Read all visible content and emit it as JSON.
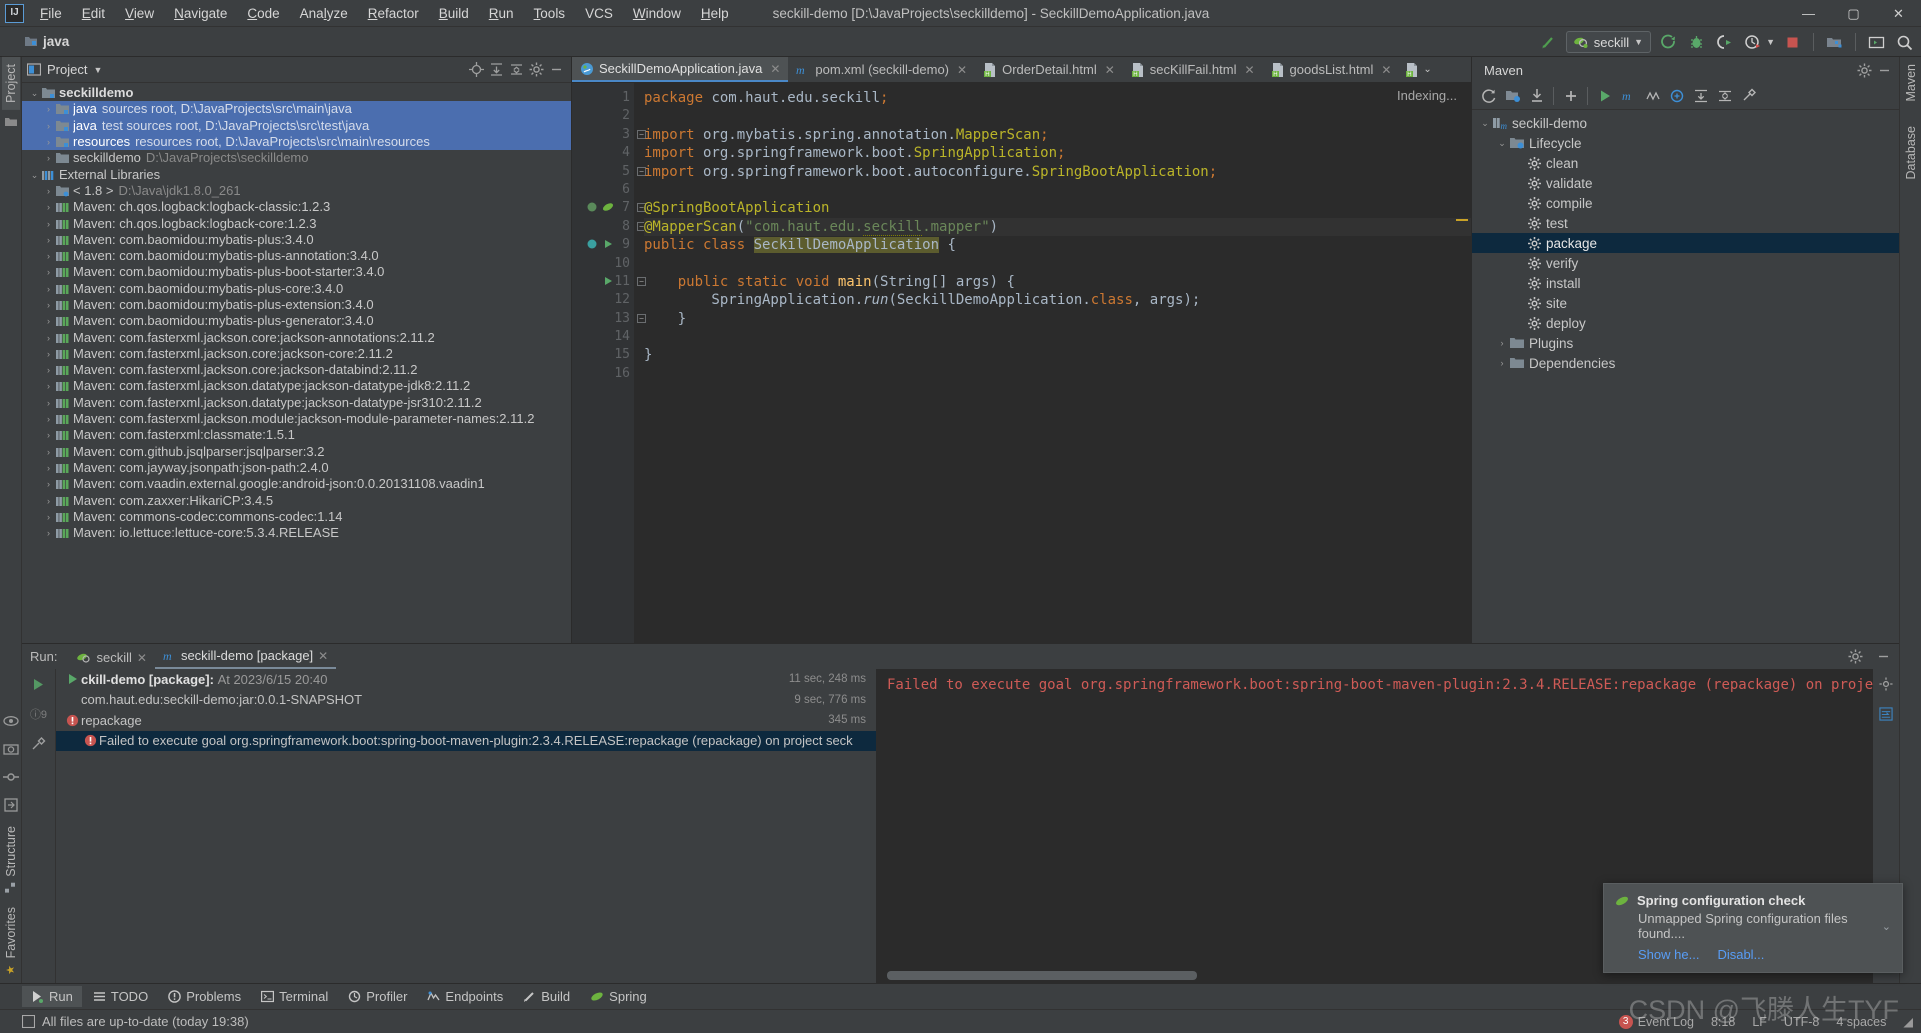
{
  "window": {
    "title": "seckill-demo [D:\\JavaProjects\\seckilldemo] - SeckillDemoApplication.java",
    "minimize": "—",
    "maximize": "▢",
    "close": "✕"
  },
  "menu": [
    "File",
    "Edit",
    "View",
    "Navigate",
    "Code",
    "Analyze",
    "Refactor",
    "Build",
    "Run",
    "Tools",
    "VCS",
    "Window",
    "Help"
  ],
  "navbar": {
    "crumb": "java"
  },
  "toolbar": {
    "run_config": "seckill",
    "icons": [
      "build-icon",
      "run-icon",
      "debug-icon",
      "run-with-coverage-icon",
      "profiler-icon",
      "stop-icon",
      "project-structure-icon",
      "terminal-icon",
      "search-everywhere-icon"
    ]
  },
  "left_strip": {
    "tabs": [
      "Project"
    ],
    "bottom_tabs": [
      "Structure",
      "Favorites"
    ]
  },
  "right_strip": {
    "tabs": [
      "Maven",
      "Database"
    ]
  },
  "project_panel": {
    "title": "Project",
    "tree": [
      {
        "indent": 0,
        "arrow": "v",
        "icon": "module-icon",
        "label": "seckilldemo",
        "dim": "",
        "bold": true,
        "selected": false
      },
      {
        "indent": 1,
        "arrow": ">",
        "icon": "source-folder-icon",
        "label": "java",
        "dim": "sources root,  D:\\JavaProjects\\src\\main\\java",
        "bold": false,
        "selected": true
      },
      {
        "indent": 1,
        "arrow": ">",
        "icon": "source-folder-icon",
        "label": "java",
        "dim": "test sources root,  D:\\JavaProjects\\src\\test\\java",
        "bold": false,
        "selected": true
      },
      {
        "indent": 1,
        "arrow": ">",
        "icon": "source-folder-icon",
        "label": "resources",
        "dim": "resources root,  D:\\JavaProjects\\src\\main\\resources",
        "bold": false,
        "selected": true
      },
      {
        "indent": 1,
        "arrow": ">",
        "icon": "folder-icon",
        "label": "seckilldemo",
        "dim": "D:\\JavaProjects\\seckilldemo",
        "bold": false,
        "selected": false
      },
      {
        "indent": 0,
        "arrow": "v",
        "icon": "libraries-icon",
        "label": "External Libraries",
        "dim": "",
        "bold": false,
        "selected": false
      },
      {
        "indent": 1,
        "arrow": ">",
        "icon": "jdk-icon",
        "label": "< 1.8 >",
        "dim": "D:\\Java\\jdk1.8.0_261",
        "bold": false,
        "selected": false
      },
      {
        "indent": 1,
        "arrow": ">",
        "icon": "maven-lib-icon",
        "label": "Maven: ch.qos.logback:logback-classic:1.2.3",
        "dim": "",
        "bold": false,
        "selected": false
      },
      {
        "indent": 1,
        "arrow": ">",
        "icon": "maven-lib-icon",
        "label": "Maven: ch.qos.logback:logback-core:1.2.3",
        "dim": "",
        "bold": false,
        "selected": false
      },
      {
        "indent": 1,
        "arrow": ">",
        "icon": "maven-lib-icon",
        "label": "Maven: com.baomidou:mybatis-plus:3.4.0",
        "dim": "",
        "bold": false,
        "selected": false
      },
      {
        "indent": 1,
        "arrow": ">",
        "icon": "maven-lib-icon",
        "label": "Maven: com.baomidou:mybatis-plus-annotation:3.4.0",
        "dim": "",
        "bold": false,
        "selected": false
      },
      {
        "indent": 1,
        "arrow": ">",
        "icon": "maven-lib-icon",
        "label": "Maven: com.baomidou:mybatis-plus-boot-starter:3.4.0",
        "dim": "",
        "bold": false,
        "selected": false
      },
      {
        "indent": 1,
        "arrow": ">",
        "icon": "maven-lib-icon",
        "label": "Maven: com.baomidou:mybatis-plus-core:3.4.0",
        "dim": "",
        "bold": false,
        "selected": false
      },
      {
        "indent": 1,
        "arrow": ">",
        "icon": "maven-lib-icon",
        "label": "Maven: com.baomidou:mybatis-plus-extension:3.4.0",
        "dim": "",
        "bold": false,
        "selected": false
      },
      {
        "indent": 1,
        "arrow": ">",
        "icon": "maven-lib-icon",
        "label": "Maven: com.baomidou:mybatis-plus-generator:3.4.0",
        "dim": "",
        "bold": false,
        "selected": false
      },
      {
        "indent": 1,
        "arrow": ">",
        "icon": "maven-lib-icon",
        "label": "Maven: com.fasterxml.jackson.core:jackson-annotations:2.11.2",
        "dim": "",
        "bold": false,
        "selected": false
      },
      {
        "indent": 1,
        "arrow": ">",
        "icon": "maven-lib-icon",
        "label": "Maven: com.fasterxml.jackson.core:jackson-core:2.11.2",
        "dim": "",
        "bold": false,
        "selected": false
      },
      {
        "indent": 1,
        "arrow": ">",
        "icon": "maven-lib-icon",
        "label": "Maven: com.fasterxml.jackson.core:jackson-databind:2.11.2",
        "dim": "",
        "bold": false,
        "selected": false
      },
      {
        "indent": 1,
        "arrow": ">",
        "icon": "maven-lib-icon",
        "label": "Maven: com.fasterxml.jackson.datatype:jackson-datatype-jdk8:2.11.2",
        "dim": "",
        "bold": false,
        "selected": false
      },
      {
        "indent": 1,
        "arrow": ">",
        "icon": "maven-lib-icon",
        "label": "Maven: com.fasterxml.jackson.datatype:jackson-datatype-jsr310:2.11.2",
        "dim": "",
        "bold": false,
        "selected": false
      },
      {
        "indent": 1,
        "arrow": ">",
        "icon": "maven-lib-icon",
        "label": "Maven: com.fasterxml.jackson.module:jackson-module-parameter-names:2.11.2",
        "dim": "",
        "bold": false,
        "selected": false
      },
      {
        "indent": 1,
        "arrow": ">",
        "icon": "maven-lib-icon",
        "label": "Maven: com.fasterxml:classmate:1.5.1",
        "dim": "",
        "bold": false,
        "selected": false
      },
      {
        "indent": 1,
        "arrow": ">",
        "icon": "maven-lib-icon",
        "label": "Maven: com.github.jsqlparser:jsqlparser:3.2",
        "dim": "",
        "bold": false,
        "selected": false
      },
      {
        "indent": 1,
        "arrow": ">",
        "icon": "maven-lib-icon",
        "label": "Maven: com.jayway.jsonpath:json-path:2.4.0",
        "dim": "",
        "bold": false,
        "selected": false
      },
      {
        "indent": 1,
        "arrow": ">",
        "icon": "maven-lib-icon",
        "label": "Maven: com.vaadin.external.google:android-json:0.0.20131108.vaadin1",
        "dim": "",
        "bold": false,
        "selected": false
      },
      {
        "indent": 1,
        "arrow": ">",
        "icon": "maven-lib-icon",
        "label": "Maven: com.zaxxer:HikariCP:3.4.5",
        "dim": "",
        "bold": false,
        "selected": false
      },
      {
        "indent": 1,
        "arrow": ">",
        "icon": "maven-lib-icon",
        "label": "Maven: commons-codec:commons-codec:1.14",
        "dim": "",
        "bold": false,
        "selected": false
      },
      {
        "indent": 1,
        "arrow": ">",
        "icon": "maven-lib-icon",
        "label": "Maven: io.lettuce:lettuce-core:5.3.4.RELEASE",
        "dim": "",
        "bold": false,
        "selected": false
      }
    ]
  },
  "editor": {
    "tabs": [
      {
        "label": "SeckillDemoApplication.java",
        "icon": "java-class-icon",
        "active": true
      },
      {
        "label": "pom.xml (seckill-demo)",
        "icon": "maven-xml-icon",
        "active": false
      },
      {
        "label": "OrderDetail.html",
        "icon": "html-icon",
        "active": false
      },
      {
        "label": "secKillFail.html",
        "icon": "html-icon",
        "active": false
      },
      {
        "label": "goodsList.html",
        "icon": "html-icon",
        "active": false
      }
    ],
    "status": "Indexing...",
    "lines": [
      {
        "n": 1,
        "html": "<span class=\"kw\">package</span> com.haut.edu.seckill<span class=\"kw\">;</span>"
      },
      {
        "n": 2,
        "html": ""
      },
      {
        "n": 3,
        "html": "<span class=\"kw\">import</span> org.mybatis.spring.annotation.<span class=\"ylw\">MapperScan</span><span class=\"kw\">;</span>"
      },
      {
        "n": 4,
        "html": "<span class=\"kw\">import</span> org.springframework.boot.<span class=\"ylw\">SpringApplication</span><span class=\"kw\">;</span>"
      },
      {
        "n": 5,
        "html": "<span class=\"kw\">import</span> org.springframework.boot.autoconfigure.<span class=\"ylw\">SpringBootApplication</span><span class=\"kw\">;</span>"
      },
      {
        "n": 6,
        "html": ""
      },
      {
        "n": 7,
        "html": "<span class=\"an\">@SpringBootApplication</span>"
      },
      {
        "n": 8,
        "html": "<span class=\"an\">@MapperScan</span>(<span class=\"st\">\"com.haut.edu.<span class=\"squig\">seckill</span>.mapper\"</span>)",
        "hl": true
      },
      {
        "n": 9,
        "html": "<span class=\"kw\">public class</span> <span class=\"warnbg\">SeckillDemoApplication</span> {"
      },
      {
        "n": 10,
        "html": ""
      },
      {
        "n": 11,
        "html": "    <span class=\"kw\">public static void</span> <span class=\"mth\">main</span>(String[] args) {"
      },
      {
        "n": 12,
        "html": "        SpringApplication.<span class=\"itl\">run</span>(SeckillDemoApplication.<span class=\"kw\">class</span>, args);"
      },
      {
        "n": 13,
        "html": "    }"
      },
      {
        "n": 14,
        "html": ""
      },
      {
        "n": 15,
        "html": "}"
      },
      {
        "n": 16,
        "html": ""
      }
    ]
  },
  "maven_panel": {
    "title": "Maven",
    "toolbar_icons": [
      "reload-icon",
      "add-module-icon",
      "download-sources-icon",
      "add-icon",
      "run-icon",
      "execute-goal-icon",
      "toggle-skip-tests-icon",
      "profiler-icon",
      "expand-all-icon",
      "collapse-all-icon",
      "settings-icon"
    ],
    "tree": [
      {
        "indent": 0,
        "arrow": "v",
        "icon": "maven-project-icon",
        "label": "seckill-demo",
        "selected": false
      },
      {
        "indent": 1,
        "arrow": "v",
        "icon": "lifecycle-folder-icon",
        "label": "Lifecycle",
        "selected": false
      },
      {
        "indent": 2,
        "arrow": "",
        "icon": "goal-icon",
        "label": "clean",
        "selected": false
      },
      {
        "indent": 2,
        "arrow": "",
        "icon": "goal-icon",
        "label": "validate",
        "selected": false
      },
      {
        "indent": 2,
        "arrow": "",
        "icon": "goal-icon",
        "label": "compile",
        "selected": false
      },
      {
        "indent": 2,
        "arrow": "",
        "icon": "goal-icon",
        "label": "test",
        "selected": false
      },
      {
        "indent": 2,
        "arrow": "",
        "icon": "goal-icon",
        "label": "package",
        "selected": true
      },
      {
        "indent": 2,
        "arrow": "",
        "icon": "goal-icon",
        "label": "verify",
        "selected": false
      },
      {
        "indent": 2,
        "arrow": "",
        "icon": "goal-icon",
        "label": "install",
        "selected": false
      },
      {
        "indent": 2,
        "arrow": "",
        "icon": "goal-icon",
        "label": "site",
        "selected": false
      },
      {
        "indent": 2,
        "arrow": "",
        "icon": "goal-icon",
        "label": "deploy",
        "selected": false
      },
      {
        "indent": 1,
        "arrow": ">",
        "icon": "plugins-folder-icon",
        "label": "Plugins",
        "selected": false
      },
      {
        "indent": 1,
        "arrow": ">",
        "icon": "dependencies-folder-icon",
        "label": "Dependencies",
        "selected": false
      }
    ]
  },
  "run_panel": {
    "label": "Run:",
    "tabs": [
      {
        "label": "seckill",
        "icon": "spring-run-icon",
        "active": false
      },
      {
        "label": "seckill-demo [package]",
        "icon": "maven-icon",
        "active": true
      }
    ],
    "rows": [
      {
        "icon": "run-green-icon",
        "bold": "ckill-demo [package]:",
        "text": "At 2023/6/15 20:40",
        "time": "11 sec, 248 ms",
        "selected": false,
        "indent": 0
      },
      {
        "icon": "",
        "bold": "",
        "text": "com.haut.edu:seckill-demo:jar:0.0.1-SNAPSHOT",
        "time": "9 sec, 776 ms",
        "selected": false,
        "indent": 0
      },
      {
        "icon": "error-icon",
        "bold": "",
        "text": "repackage",
        "time": "345 ms",
        "selected": false,
        "indent": 0
      },
      {
        "icon": "error-icon",
        "bold": "",
        "text": "Failed to execute goal org.springframework.boot:spring-boot-maven-plugin:2.3.4.RELEASE:repackage (repackage) on project seck",
        "time": "",
        "selected": true,
        "indent": 1
      }
    ],
    "console": "Failed to execute goal org.springframework.boot:spring-boot-maven-plugin:2.3.4.RELEASE:repackage (repackage) on project seckil"
  },
  "notification": {
    "icon": "spring-leaf-icon",
    "title": "Spring configuration check",
    "body": "Unmapped Spring configuration files found....",
    "actions": [
      "Show he...",
      "Disabl..."
    ]
  },
  "tool_windows": [
    {
      "label": "Run",
      "icon": "run-icon",
      "active": true
    },
    {
      "label": "TODO",
      "icon": "todo-icon",
      "active": false
    },
    {
      "label": "Problems",
      "icon": "problems-icon",
      "active": false
    },
    {
      "label": "Terminal",
      "icon": "terminal-icon",
      "active": false
    },
    {
      "label": "Profiler",
      "icon": "profiler-icon",
      "active": false
    },
    {
      "label": "Endpoints",
      "icon": "endpoints-icon",
      "active": false
    },
    {
      "label": "Build",
      "icon": "build-icon",
      "active": false
    },
    {
      "label": "Spring",
      "icon": "spring-leaf-icon",
      "active": false
    }
  ],
  "statusbar": {
    "message": "All files are up-to-date (today 19:38)",
    "event_log": "Event Log",
    "event_badge": "3",
    "position": "8:18",
    "line_sep": "LF",
    "encoding": "UTF-8",
    "indent": "4 spaces"
  },
  "watermark": "CSDN @飞滕人生TYF",
  "colors": {
    "accent_blue": "#4b6eaf",
    "selection_maven": "#0d293e",
    "error_red": "#cf5b56",
    "link_blue": "#589df6",
    "editor_bg": "#2b2b2b",
    "panel_bg": "#3c3f41"
  }
}
